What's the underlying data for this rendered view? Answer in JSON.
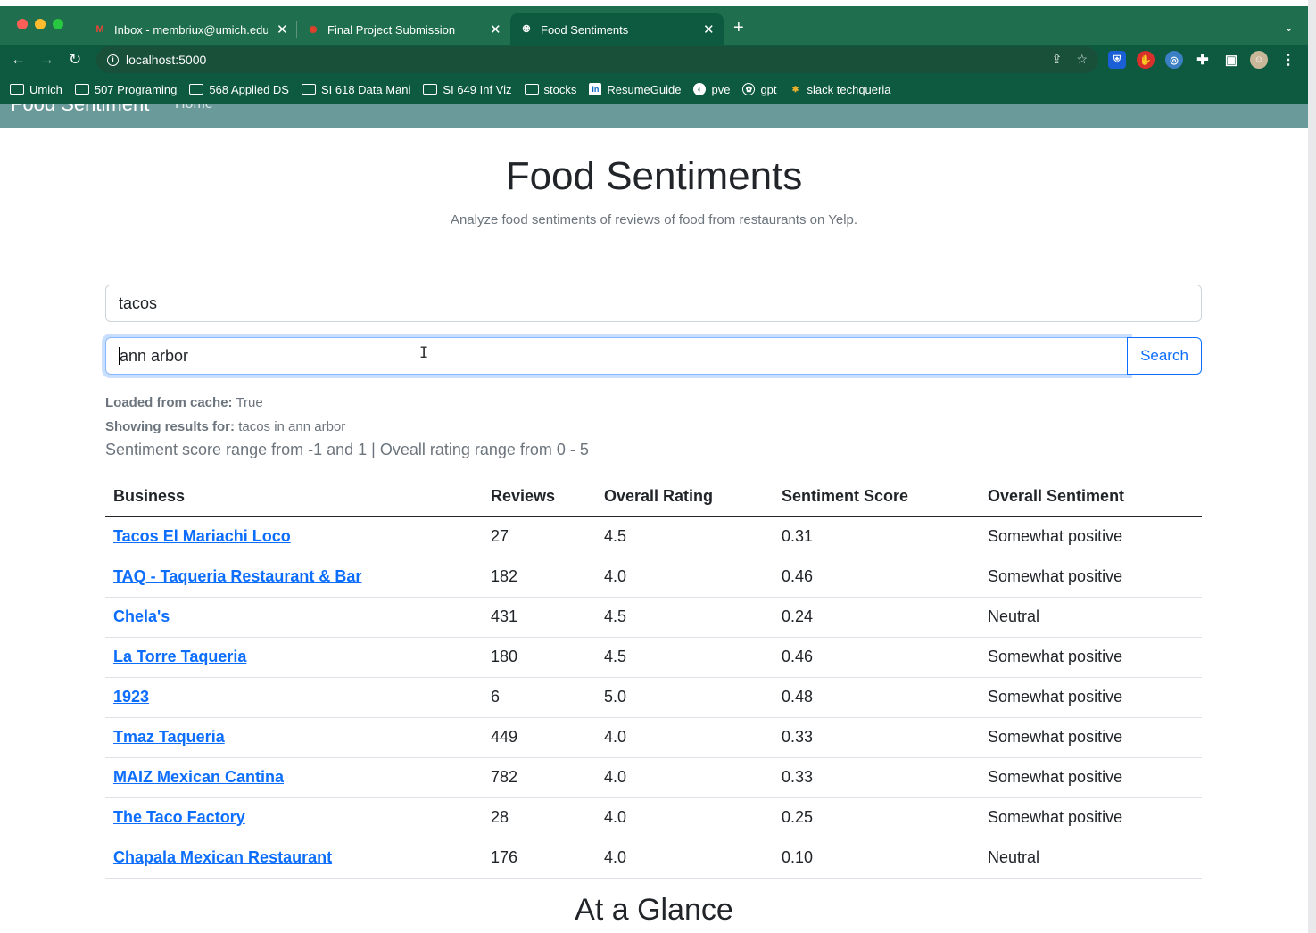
{
  "browser": {
    "tabs": [
      {
        "title": "Inbox - membriux@umich.edu",
        "icon": "gmail-icon",
        "active": false
      },
      {
        "title": "Final Project Submission",
        "icon": "canvas-icon",
        "active": false
      },
      {
        "title": "Food Sentiments",
        "icon": "globe-icon",
        "active": true
      }
    ],
    "new_tab": "+",
    "url": "localhost:5000",
    "bookmarks": [
      {
        "label": "Umich",
        "icon": "folder-icon"
      },
      {
        "label": "507 Programing",
        "icon": "folder-icon"
      },
      {
        "label": "568 Applied DS",
        "icon": "folder-icon"
      },
      {
        "label": "SI 618 Data Mani",
        "icon": "folder-icon"
      },
      {
        "label": "SI 649 Inf Viz",
        "icon": "folder-icon"
      },
      {
        "label": "stocks",
        "icon": "folder-icon"
      },
      {
        "label": "ResumeGuide",
        "icon": "linkedin-icon"
      },
      {
        "label": "pve",
        "icon": "globe-icon"
      },
      {
        "label": "gpt",
        "icon": "openai-icon"
      },
      {
        "label": "slack techqueria",
        "icon": "slack-icon"
      }
    ]
  },
  "navbar": {
    "brand": "Food Sentiment",
    "home": "Home"
  },
  "page": {
    "title": "Food Sentiments",
    "lead": "Analyze food sentiments of reviews of food from restaurants on Yelp.",
    "food_input": "tacos",
    "location_input": "ann arbor",
    "search_label": "Search",
    "cache_label": "Loaded from cache:",
    "cache_value": "True",
    "showing_label": "Showing results for:",
    "showing_value": "tacos in ann arbor",
    "range_text": "Sentiment score range from -1 and 1 | Oveall rating range from 0 - 5",
    "glance": "At a Glance"
  },
  "table": {
    "headers": [
      "Business",
      "Reviews",
      "Overall Rating",
      "Sentiment Score",
      "Overall Sentiment"
    ],
    "rows": [
      [
        "Tacos El Mariachi Loco",
        "27",
        "4.5",
        "0.31",
        "Somewhat positive"
      ],
      [
        "TAQ - Taqueria Restaurant & Bar",
        "182",
        "4.0",
        "0.46",
        "Somewhat positive"
      ],
      [
        "Chela's",
        "431",
        "4.5",
        "0.24",
        "Neutral"
      ],
      [
        "La Torre Taqueria",
        "180",
        "4.5",
        "0.46",
        "Somewhat positive"
      ],
      [
        "1923",
        "6",
        "5.0",
        "0.48",
        "Somewhat positive"
      ],
      [
        "Tmaz Taqueria",
        "449",
        "4.0",
        "0.33",
        "Somewhat positive"
      ],
      [
        "MAIZ Mexican Cantina",
        "782",
        "4.0",
        "0.33",
        "Somewhat positive"
      ],
      [
        "The Taco Factory",
        "28",
        "4.0",
        "0.25",
        "Somewhat positive"
      ],
      [
        "Chapala Mexican Restaurant",
        "176",
        "4.0",
        "0.10",
        "Neutral"
      ]
    ]
  },
  "colors": {
    "chrome": "#0e5a40",
    "tabstrip": "#1f6f4e",
    "navbar": "#6b9a9a",
    "link": "#0d6efd"
  }
}
